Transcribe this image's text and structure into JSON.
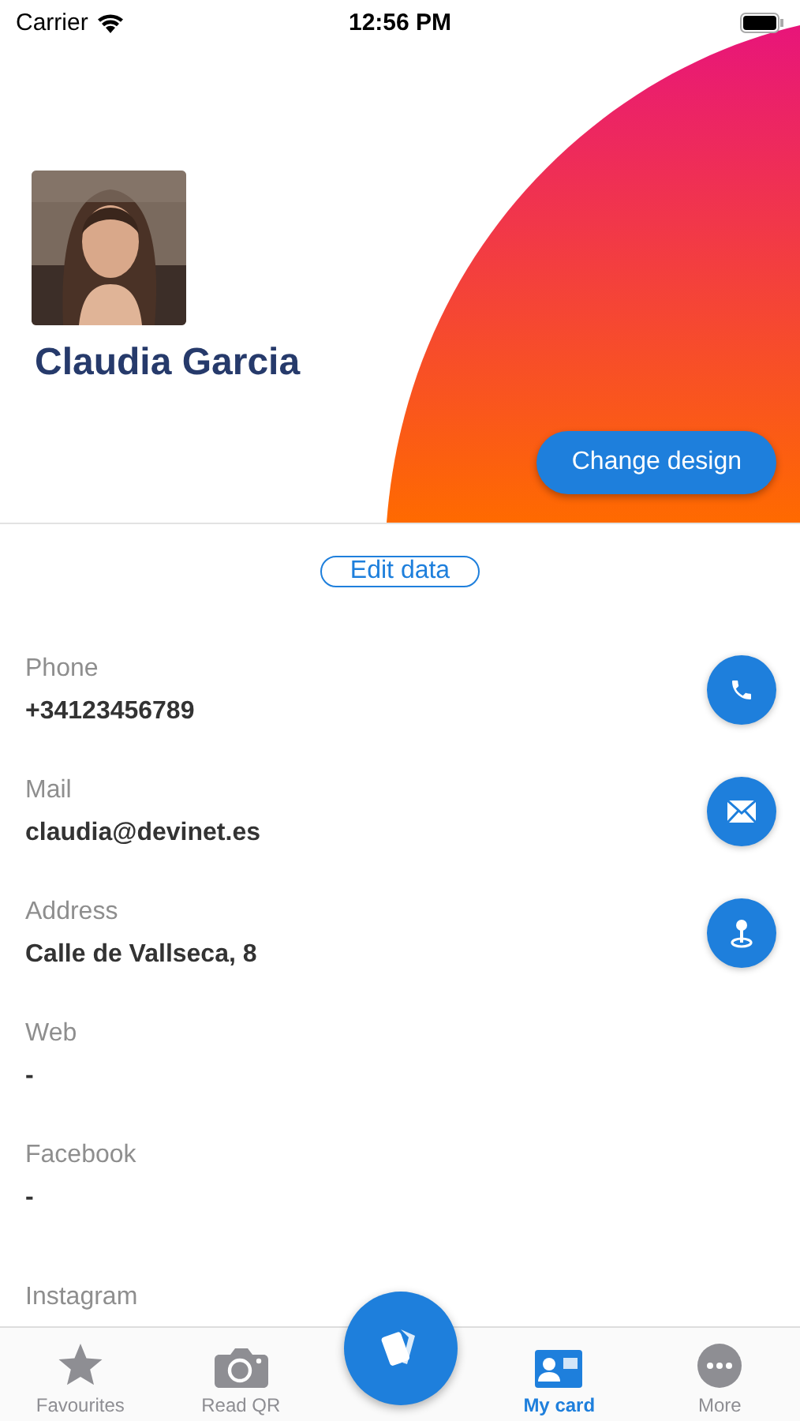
{
  "status_bar": {
    "carrier": "Carrier",
    "time": "12:56 PM"
  },
  "profile": {
    "name": "Claudia Garcia",
    "change_design": "Change design"
  },
  "edit_button": "Edit data",
  "fields": [
    {
      "label": "Phone",
      "value": "+34123456789",
      "kind": "phone"
    },
    {
      "label": "Mail",
      "value": "claudia@devinet.es",
      "kind": "mail"
    },
    {
      "label": "Address",
      "value": "Calle de Vallseca, 8",
      "kind": "location"
    },
    {
      "label": "Web",
      "value": "-",
      "kind": "plain"
    },
    {
      "label": "Facebook",
      "value": "-",
      "kind": "plain"
    },
    {
      "label": "Instagram",
      "kind": "plain"
    }
  ],
  "tab_bar": [
    {
      "label": "Favourites",
      "kind": "star",
      "selected": false
    },
    {
      "label": "Read QR",
      "kind": "camera",
      "selected": false
    },
    {
      "label": "My card",
      "kind": "card",
      "selected": true
    },
    {
      "label": "More",
      "kind": "more",
      "selected": false
    }
  ]
}
